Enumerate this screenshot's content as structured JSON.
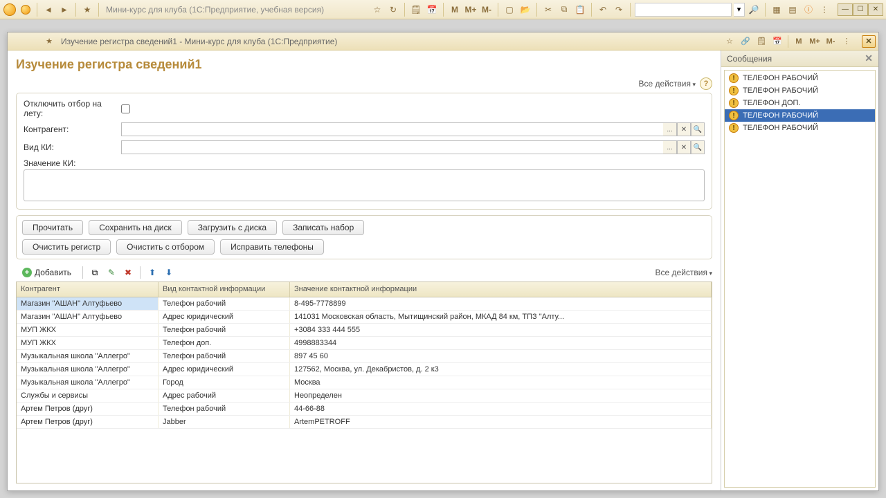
{
  "outer": {
    "title": "Мини-курс для клуба  (1С:Предприятие, учебная версия)"
  },
  "inner": {
    "title": "Изучение регистра сведений1 - Мини-курс для клуба  (1С:Предприятие)"
  },
  "page": {
    "title": "Изучение регистра сведений1",
    "all_actions": "Все действия"
  },
  "filters": {
    "disable_onfly": "Отключить отбор на лету:",
    "counterparty": "Контрагент:",
    "ki_type": "Вид КИ:",
    "ki_value": "Значение КИ:"
  },
  "buttons": {
    "read": "Прочитать",
    "save_disk": "Сохранить на диск",
    "load_disk": "Загрузить с диска",
    "write_set": "Записать набор",
    "clear_register": "Очистить регистр",
    "clear_filter": "Очистить с отбором",
    "fix_phones": "Исправить телефоны",
    "add": "Добавить",
    "all_actions": "Все действия"
  },
  "grid": {
    "headers": {
      "c1": "Контрагент",
      "c2": "Вид контактной информации",
      "c3": "Значение контактной информации"
    },
    "rows": [
      {
        "c1": "Магазин \"АШАН\" Алтуфьево",
        "c2": "Телефон рабочий",
        "c3": "8-495-7778899",
        "sel": true
      },
      {
        "c1": "Магазин \"АШАН\" Алтуфьево",
        "c2": "Адрес юридический",
        "c3": "141031 Московская область, Мытищинский район, МКАД 84 км, ТПЗ \"Алту..."
      },
      {
        "c1": "МУП ЖКХ",
        "c2": "Телефон рабочий",
        "c3": "+3084 333 444 555"
      },
      {
        "c1": "МУП ЖКХ",
        "c2": "Телефон доп.",
        "c3": "4998883344"
      },
      {
        "c1": "Музыкальная школа \"Аллегро\"",
        "c2": "Телефон рабочий",
        "c3": "897 45 60"
      },
      {
        "c1": "Музыкальная школа \"Аллегро\"",
        "c2": "Адрес юридический",
        "c3": "127562, Москва, ул. Декабристов, д. 2 к3"
      },
      {
        "c1": "Музыкальная школа \"Аллегро\"",
        "c2": "Город",
        "c3": "Москва"
      },
      {
        "c1": "Службы и сервисы",
        "c2": "Адрес рабочий",
        "c3": "Неопределен"
      },
      {
        "c1": "Артем Петров (друг)",
        "c2": "Телефон рабочий",
        "c3": "44-66-88"
      },
      {
        "c1": "Артем Петров (друг)",
        "c2": "Jabber",
        "c3": "ArtemPETROFF"
      }
    ]
  },
  "messages": {
    "title": "Сообщения",
    "items": [
      {
        "text": "ТЕЛЕФОН РАБОЧИЙ"
      },
      {
        "text": "ТЕЛЕФОН РАБОЧИЙ"
      },
      {
        "text": "ТЕЛЕФОН ДОП."
      },
      {
        "text": "ТЕЛЕФОН РАБОЧИЙ",
        "sel": true
      },
      {
        "text": "ТЕЛЕФОН РАБОЧИЙ"
      }
    ]
  },
  "toolbar_letters": {
    "M": "M",
    "Mp": "M+",
    "Mm": "M-"
  }
}
